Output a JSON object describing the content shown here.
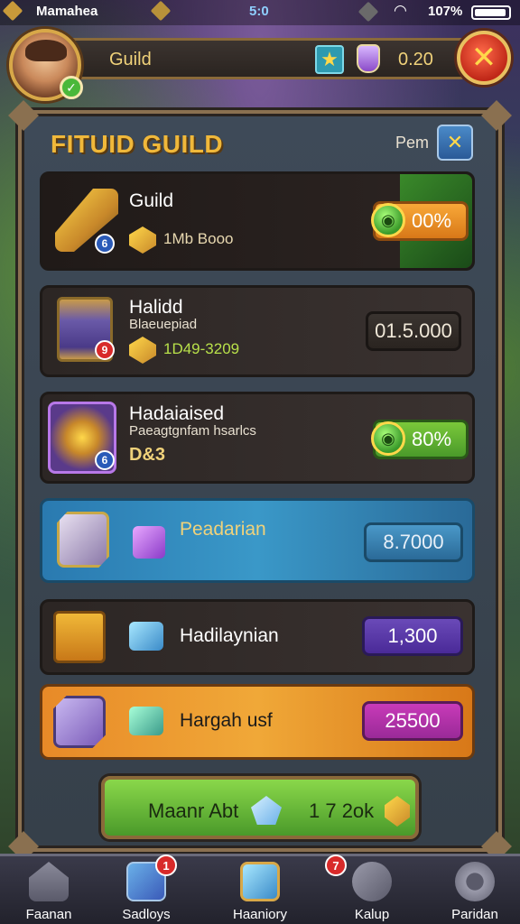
{
  "status_bar": {
    "carrier": "Mamahea",
    "time": "5:0",
    "battery": "107%"
  },
  "header": {
    "title": "Guild",
    "currency_amount": "0.20"
  },
  "panel": {
    "title": "FITUID GUILD",
    "side_label": "Pem"
  },
  "rows": [
    {
      "title": "Guild",
      "meta": "1Mb Booo",
      "pill": "00%",
      "badge": "6"
    },
    {
      "title": "Halidd",
      "sub": "Blaeuepiad",
      "meta": "1D49-3209",
      "pill": "01.5.000",
      "badge": "9"
    },
    {
      "title": "Hadaiaised",
      "sub": "Paeagtgnfam hsarlcs",
      "meta": "D&3",
      "pill": "80%",
      "badge": "6"
    },
    {
      "title": "Peadarian",
      "pill": "8.7000"
    },
    {
      "title": "Hadilaynian",
      "pill": "1,300"
    },
    {
      "title": "Hargah usf",
      "pill": "25500"
    }
  ],
  "action": {
    "label": "Maanr Abt",
    "price": "1 7 2ok"
  },
  "nav": [
    {
      "label": "Faanan"
    },
    {
      "label": "Sadloys",
      "badge": "1"
    },
    {
      "label": "Haaniory"
    },
    {
      "label": "Kalup",
      "badge": "7"
    },
    {
      "label": "Paridan"
    }
  ],
  "colors": {
    "accent_gold": "#f0b83a",
    "panel_bg": "#3e4a58",
    "highlight_blue": "#3a98c8",
    "highlight_orange": "#f0a838"
  }
}
